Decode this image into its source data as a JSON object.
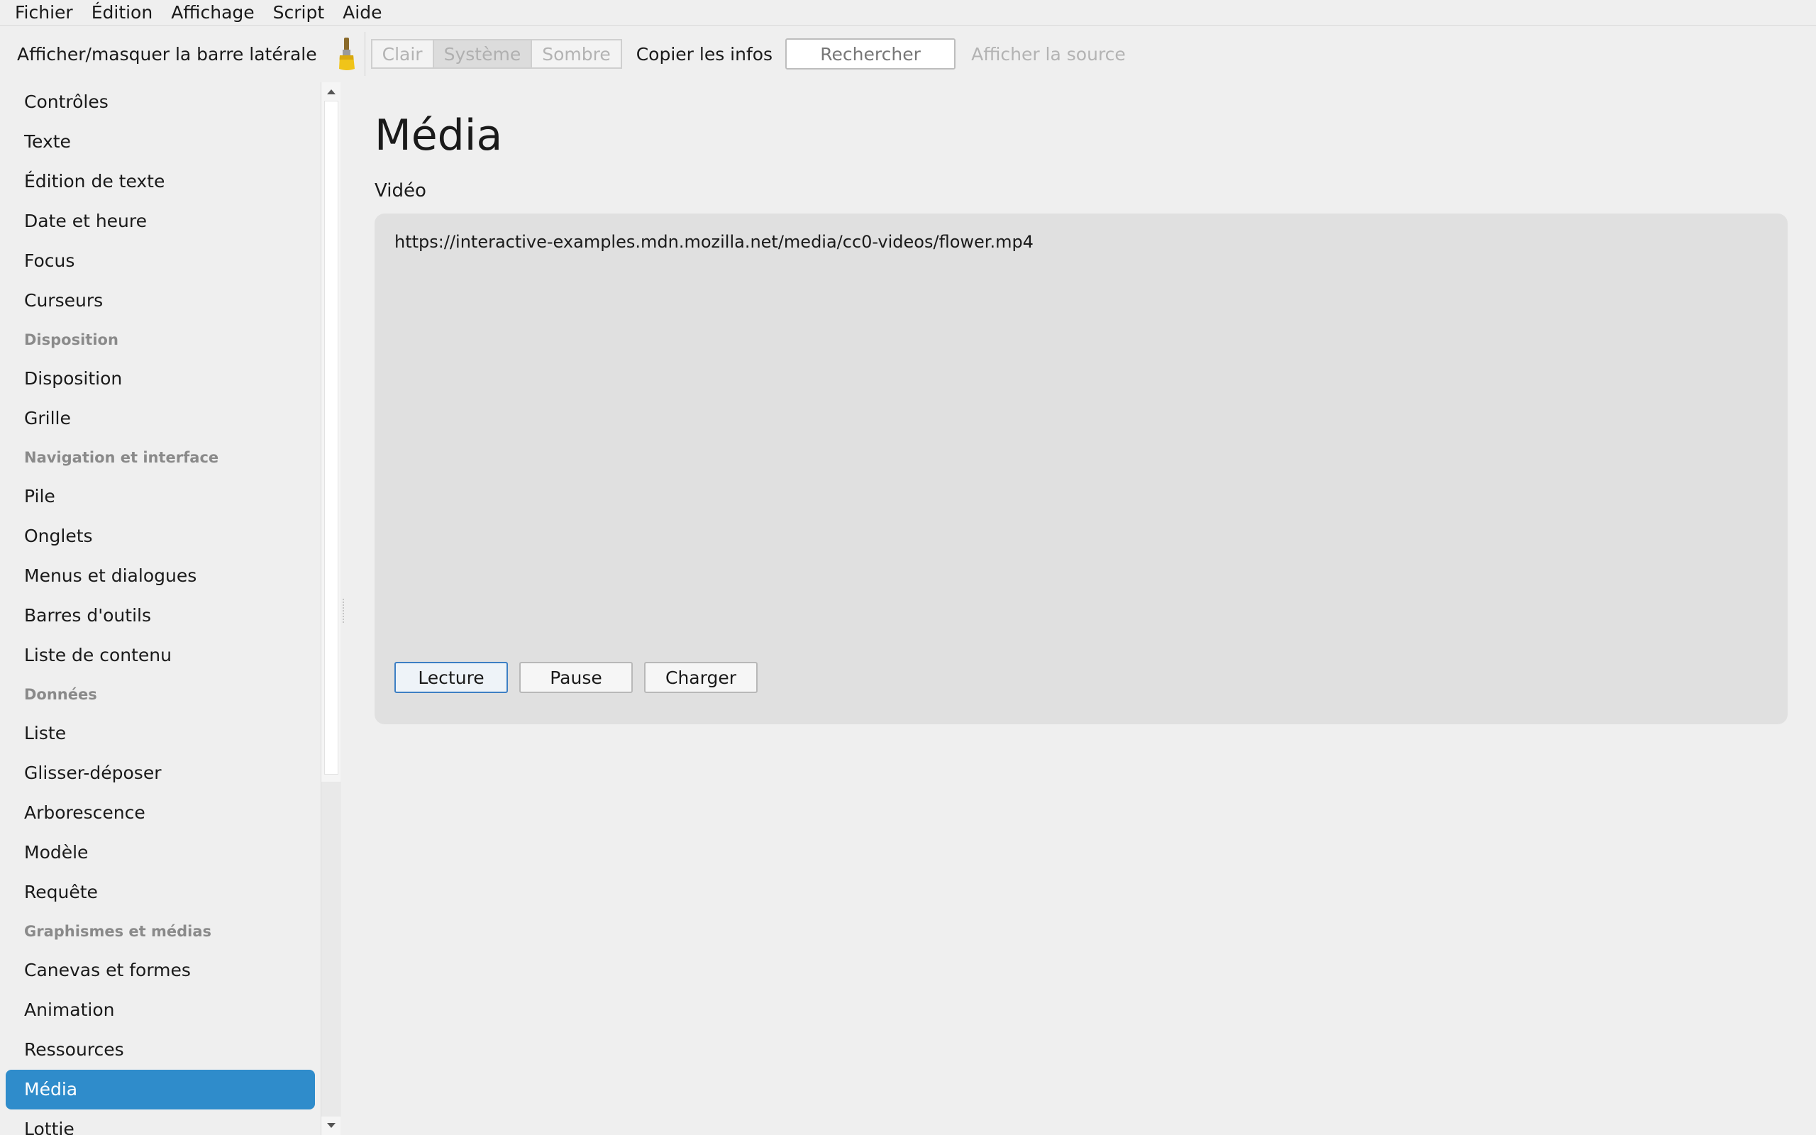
{
  "menubar": {
    "items": [
      "Fichier",
      "Édition",
      "Affichage",
      "Script",
      "Aide"
    ]
  },
  "toolbar": {
    "sidebar_toggle_label": "Afficher/masquer la barre latérale",
    "brush_icon": "paintbrush-icon",
    "theme_buttons": [
      "Clair",
      "Système",
      "Sombre"
    ],
    "theme_selected": "Système",
    "copy_info_label": "Copier les infos",
    "search_placeholder": "Rechercher",
    "show_source_label": "Afficher la source"
  },
  "sidebar": {
    "entries": [
      {
        "type": "item",
        "label": "Contrôles"
      },
      {
        "type": "item",
        "label": "Texte"
      },
      {
        "type": "item",
        "label": "Édition de texte"
      },
      {
        "type": "item",
        "label": "Date et heure"
      },
      {
        "type": "item",
        "label": "Focus"
      },
      {
        "type": "item",
        "label": "Curseurs"
      },
      {
        "type": "header",
        "label": "Disposition"
      },
      {
        "type": "item",
        "label": "Disposition"
      },
      {
        "type": "item",
        "label": "Grille"
      },
      {
        "type": "header",
        "label": "Navigation et interface"
      },
      {
        "type": "item",
        "label": "Pile"
      },
      {
        "type": "item",
        "label": "Onglets"
      },
      {
        "type": "item",
        "label": "Menus et dialogues"
      },
      {
        "type": "item",
        "label": "Barres d'outils"
      },
      {
        "type": "item",
        "label": "Liste de contenu"
      },
      {
        "type": "header",
        "label": "Données"
      },
      {
        "type": "item",
        "label": "Liste"
      },
      {
        "type": "item",
        "label": "Glisser-déposer"
      },
      {
        "type": "item",
        "label": "Arborescence"
      },
      {
        "type": "item",
        "label": "Modèle"
      },
      {
        "type": "item",
        "label": "Requête"
      },
      {
        "type": "header",
        "label": "Graphismes et médias"
      },
      {
        "type": "item",
        "label": "Canevas et formes"
      },
      {
        "type": "item",
        "label": "Animation"
      },
      {
        "type": "item",
        "label": "Ressources"
      },
      {
        "type": "item",
        "label": "Média",
        "selected": true
      },
      {
        "type": "item",
        "label": "Lottie"
      }
    ]
  },
  "main": {
    "title": "Média",
    "section_label": "Vidéo",
    "video_url": "https://interactive-examples.mdn.mozilla.net/media/cc0-videos/flower.mp4",
    "buttons": {
      "play": "Lecture",
      "pause": "Pause",
      "load": "Charger"
    }
  },
  "colors": {
    "selection": "#2f8ccb",
    "panel_background": "#e0e0e0",
    "window_background": "#efefef"
  }
}
